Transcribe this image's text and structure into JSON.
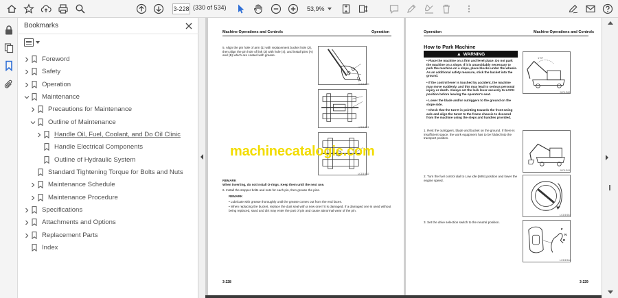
{
  "toolbar": {
    "page_current": "3-228",
    "page_count": "(330 of 534)",
    "zoom": "53,9%",
    "accent": "#2f6fd6"
  },
  "bookmarks": {
    "title": "Bookmarks",
    "items": [
      {
        "label": "Foreword",
        "level": 0,
        "expand": "collapsed"
      },
      {
        "label": "Safety",
        "level": 0,
        "expand": "collapsed"
      },
      {
        "label": "Operation",
        "level": 0,
        "expand": "collapsed"
      },
      {
        "label": "Maintenance",
        "level": 0,
        "expand": "expanded"
      },
      {
        "label": "Precautions for Maintenance",
        "level": 1,
        "expand": "collapsed"
      },
      {
        "label": "Outline of Maintenance",
        "level": 1,
        "expand": "expanded"
      },
      {
        "label": "Handle Oil, Fuel, Coolant, and Do Oil Clinic",
        "level": 2,
        "expand": "collapsed",
        "selected": true
      },
      {
        "label": "Handle Electrical Components",
        "level": 2,
        "expand": "none"
      },
      {
        "label": "Outline of Hydraulic System",
        "level": 2,
        "expand": "none"
      },
      {
        "label": "Standard Tightening Torque for Bolts and Nuts",
        "level": 1,
        "expand": "none"
      },
      {
        "label": "Maintenance Schedule",
        "level": 1,
        "expand": "collapsed"
      },
      {
        "label": "Maintenance Procedure",
        "level": 1,
        "expand": "collapsed"
      },
      {
        "label": "Specifications",
        "level": 0,
        "expand": "collapsed"
      },
      {
        "label": "Attachments and Options",
        "level": 0,
        "expand": "collapsed"
      },
      {
        "label": "Replacement Parts",
        "level": 0,
        "expand": "collapsed"
      },
      {
        "label": "Index",
        "level": 0,
        "expand": "none"
      }
    ]
  },
  "document": {
    "watermark": "machinecatalogic.com",
    "left_page": {
      "header_left": "Machine Operations and Controls",
      "header_right": "Operation",
      "step5": "5.   Align the pin hole of arm (1) with replacement bucket hole (2), then align the pin hole of link (3) with hole (4), and install pins (A) and (B) which are coated with grease.",
      "remark1_title": "REMARK",
      "remark1_text": "When inverting, do not install O-rings. Keep them until the next use.",
      "step6": "6.   Install the stopper bolts and nuts for each pin, then grease the pins.",
      "remark2_title": "REMARK",
      "bullet1": "•  Lubricate with grease thoroughly until the grease comes out from the end faces.",
      "bullet2": "•  When replacing the bucket, replace the dust seal with a new one if it is damaged. If a damaged one is used without being replaced, sand and dirt may enter the part of pin and cause abnormal wear of the pin.",
      "fig1_caption": "LCD1S30",
      "fig2_caption": "LCD1S31",
      "fig3_caption": "LCD1S32",
      "footer": "3-228"
    },
    "right_page": {
      "header_left": "Operation",
      "header_right": "Machine Operations and Controls",
      "section_title": "How to Park Machine",
      "warning_label": "WARNING",
      "w1": "•  Place the machine on a firm and level place. Do not park the machine on a slope. If it is unavoidably necessary to park the machine on a slope, place blocks under the wheels. As an additional safety measure, stick the bucket into the ground.",
      "w2": "•  If the control lever is touched by accident, the machine may move suddenly, and this may lead to serious personal injury or death. Always set the lock lever securely to LOCK position before leaving the operator's seat.",
      "w3": "•  Lower the blade and/or outriggers to the ground on the slope side.",
      "w4": "•  Check that the turret is pointing towards the front swing axle and align the turret to the frame chassis to descend from the machine using the steps and handles provided.",
      "step1": "1.   Rest the outriggers, blade and bucket on the ground. If there is insufficient space, the work equipment has to be folded into the transport position.",
      "step2": "2.   Turn the fuel control dial to Low idle (MIN) position and lower the engine speed.",
      "step3": "3.   Set the drive selection switch to the neutral position.",
      "fig_a_caption": "JLD1S86",
      "fig_b_caption": "JLD1S91",
      "fig_c_caption": "LCD1S52",
      "fig_d_caption": "LCD1S48",
      "angle_label": "170°",
      "f_label": "F",
      "n_label": "N",
      "r_label": "R",
      "footer": "3-229"
    }
  }
}
